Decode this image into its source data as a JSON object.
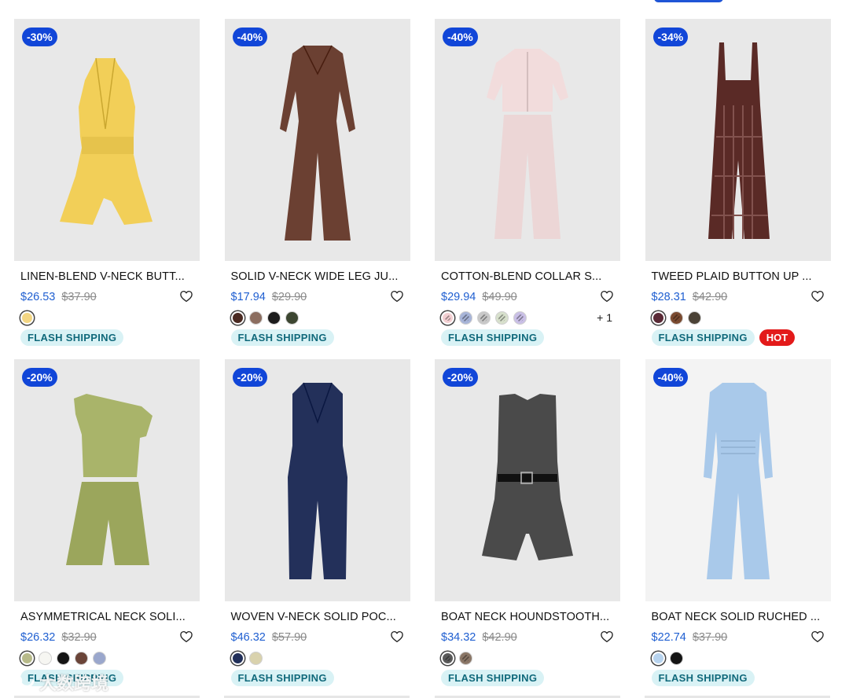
{
  "products": [
    {
      "discount": "-30%",
      "name": "LINEN-BLEND V-NECK BUTT...",
      "price": "$26.53",
      "original_price": "$37.90",
      "image_bg": "#e8e8e8",
      "garment": "halter-romper",
      "garment_color": "#f2cf58",
      "swatches": [
        {
          "color": "#f3d683",
          "selected": true
        }
      ],
      "more_colors": "",
      "badges": [
        "FLASH SHIPPING"
      ],
      "hot": ""
    },
    {
      "discount": "-40%",
      "name": "SOLID V-NECK WIDE LEG JU...",
      "price": "$17.94",
      "original_price": "$29.90",
      "image_bg": "#e8e8e8",
      "garment": "longsleeve-jumpsuit",
      "garment_color": "#6b4032",
      "swatches": [
        {
          "color": "#4a2a22",
          "selected": true
        },
        {
          "color": "#8c6e60",
          "selected": false
        },
        {
          "color": "#1c1c1c",
          "selected": false
        },
        {
          "color": "#3c4631",
          "selected": false
        }
      ],
      "more_colors": "",
      "badges": [
        "FLASH SHIPPING"
      ],
      "hot": ""
    },
    {
      "discount": "-40%",
      "name": "COTTON-BLEND COLLAR S...",
      "price": "$29.94",
      "original_price": "$49.90",
      "image_bg": "#e8e8e8",
      "garment": "shirt-set",
      "garment_color": "#f2dcdc",
      "swatches": [
        {
          "color": "#f3cfd2",
          "selected": true,
          "pattern": true
        },
        {
          "color": "#a7b4d8",
          "selected": false,
          "pattern": true
        },
        {
          "color": "#c8c8c8",
          "selected": false,
          "pattern": true
        },
        {
          "color": "#d7e0cc",
          "selected": false,
          "pattern": true
        },
        {
          "color": "#c9bfe6",
          "selected": false,
          "pattern": true
        }
      ],
      "more_colors": "+ 1",
      "badges": [
        "FLASH SHIPPING"
      ],
      "hot": ""
    },
    {
      "discount": "-34%",
      "name": "TWEED PLAID BUTTON UP ...",
      "price": "$28.31",
      "original_price": "$42.90",
      "image_bg": "#e8e8e8",
      "garment": "overall-jumpsuit",
      "garment_color": "#5a2a26",
      "swatches": [
        {
          "color": "#5a2a36",
          "selected": true
        },
        {
          "color": "#7a4a30",
          "selected": false,
          "pattern": true
        },
        {
          "color": "#4b4236",
          "selected": false
        }
      ],
      "more_colors": "",
      "badges": [
        "FLASH SHIPPING"
      ],
      "hot": "HOT"
    },
    {
      "discount": "-20%",
      "name": "ASYMMETRICAL NECK SOLI...",
      "price": "$26.32",
      "original_price": "$32.90",
      "image_bg": "#e8e8e8",
      "garment": "top-shorts-set",
      "garment_color": "#a9b46a",
      "swatches": [
        {
          "color": "#b7ba8a",
          "selected": true
        },
        {
          "color": "#f6f6f2",
          "selected": false
        },
        {
          "color": "#141414",
          "selected": false
        },
        {
          "color": "#6a4438",
          "selected": false
        },
        {
          "color": "#9aa7cc",
          "selected": false
        }
      ],
      "more_colors": "",
      "badges": [
        "FLASH SHIPPING"
      ],
      "hot": ""
    },
    {
      "discount": "-20%",
      "name": "WOVEN V-NECK SOLID POC...",
      "price": "$46.32",
      "original_price": "$57.90",
      "image_bg": "#e8e8e8",
      "garment": "vest-jumpsuit",
      "garment_color": "#23305a",
      "swatches": [
        {
          "color": "#22305a",
          "selected": true
        },
        {
          "color": "#d9d2ad",
          "selected": false
        }
      ],
      "more_colors": "",
      "badges": [
        "FLASH SHIPPING"
      ],
      "hot": ""
    },
    {
      "discount": "-20%",
      "name": "BOAT NECK HOUNDSTOOTH...",
      "price": "$34.32",
      "original_price": "$42.90",
      "image_bg": "#e8e8e8",
      "garment": "belted-romper",
      "garment_color": "#4a4a4a",
      "swatches": [
        {
          "color": "#5a5a5a",
          "selected": true,
          "pattern": true
        },
        {
          "color": "#8a7666",
          "selected": false,
          "pattern": true
        }
      ],
      "more_colors": "",
      "badges": [
        "FLASH SHIPPING"
      ],
      "hot": ""
    },
    {
      "discount": "-40%",
      "name": "BOAT NECK SOLID RUCHED ...",
      "price": "$22.74",
      "original_price": "$37.90",
      "image_bg": "#f3f3f3",
      "garment": "ruched-jumpsuit",
      "garment_color": "#a9c9ea",
      "swatches": [
        {
          "color": "#b7d3ee",
          "selected": true
        },
        {
          "color": "#141414",
          "selected": false
        }
      ],
      "more_colors": "",
      "badges": [
        "FLASH SHIPPING"
      ],
      "hot": ""
    }
  ],
  "icons": {
    "wishlist": "heart-outline-icon"
  },
  "watermark": {
    "text": "大数跨境"
  }
}
